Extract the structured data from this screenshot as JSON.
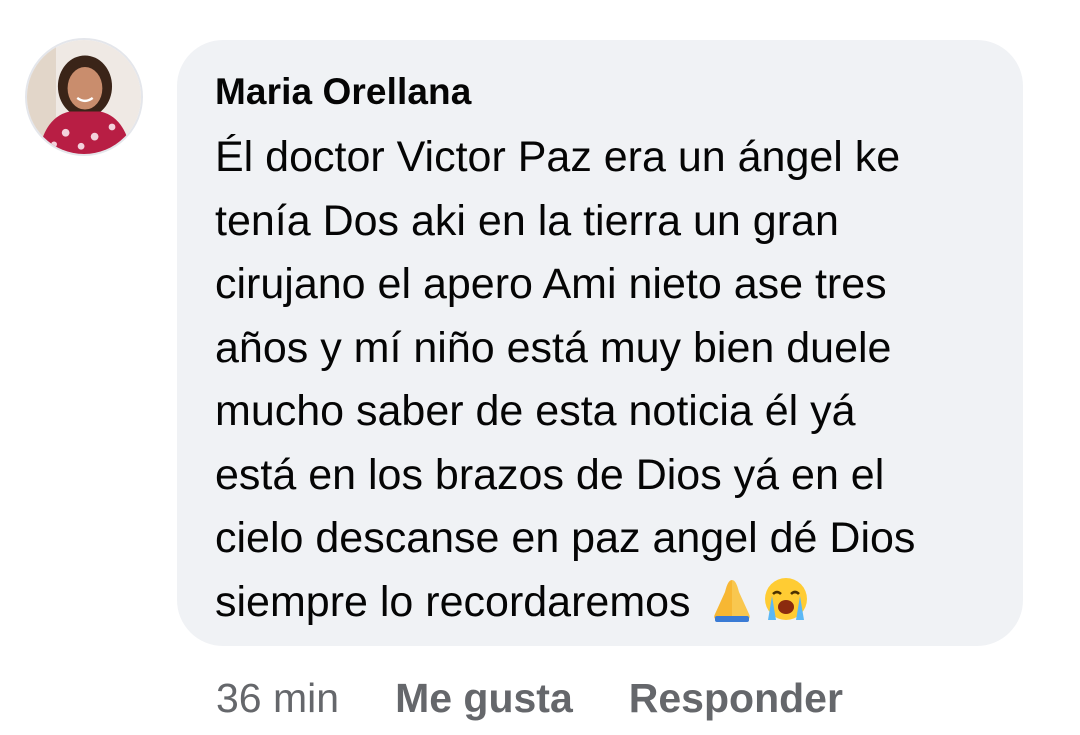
{
  "comment": {
    "author": "Maria Orellana",
    "text_lines": [
      "Él doctor Victor Paz era un ángel ke",
      "tenía Dos aki en la tierra un gran",
      "cirujano el apero Ami nieto ase tres",
      "años y mí niño está muy bien duele",
      "mucho saber de esta noticia él yá",
      "está en los brazos de Dios yá en el",
      "cielo descanse en paz angel dé Dios",
      "siempre lo recordaremos"
    ],
    "emojis": [
      "folded-hands-icon",
      "loudly-crying-face-icon"
    ],
    "bubble_color": "#f0f2f5"
  },
  "actions": {
    "time": "36 min",
    "like_label": "Me gusta",
    "reply_label": "Responder"
  }
}
